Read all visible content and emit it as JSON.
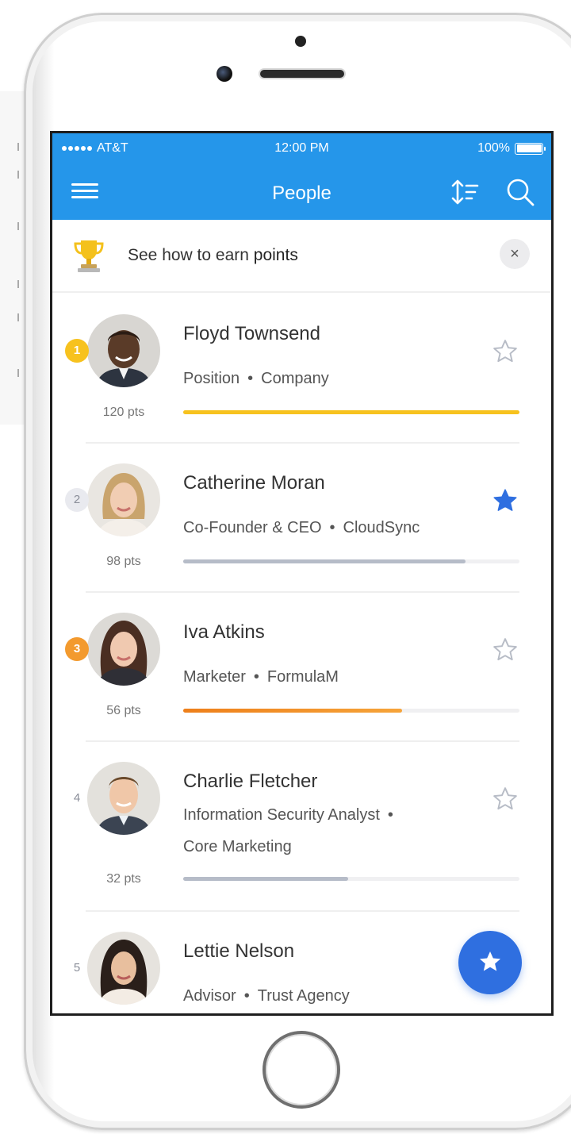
{
  "status_bar": {
    "carrier": "AT&T",
    "time": "12:00 PM",
    "battery": "100%"
  },
  "nav": {
    "title": "People",
    "menu_icon": "hamburger-icon",
    "sort_icon": "sort-icon",
    "search_icon": "search-icon"
  },
  "banner": {
    "text_prefix": "See how to earn ",
    "text_bold": "points",
    "close_label": "×",
    "icon": "trophy-icon"
  },
  "people": [
    {
      "rank": "1",
      "name": "Floyd Townsend",
      "position": "Position",
      "company": "Company",
      "points": "120 pts",
      "progress": 1.0,
      "favorite": false
    },
    {
      "rank": "2",
      "name": "Catherine Moran",
      "position": "Co-Founder & CEO",
      "company": "CloudSync",
      "points": "98 pts",
      "progress": 0.84,
      "favorite": true
    },
    {
      "rank": "3",
      "name": "Iva Atkins",
      "position": "Marketer",
      "company": "FormulaM",
      "points": "56 pts",
      "progress": 0.65,
      "favorite": false
    },
    {
      "rank": "4",
      "name": "Charlie Fletcher",
      "position": "Information Security Analyst",
      "company": "Core Marketing",
      "points": "32 pts",
      "progress": 0.49,
      "favorite": false
    },
    {
      "rank": "5",
      "name": "Lettie Nelson",
      "position": "Advisor",
      "company": "Trust Agency",
      "favorite": false
    }
  ],
  "colors": {
    "header_blue": "#2596ea",
    "gold": "#f7c21e",
    "gray": "#b6bcc8",
    "orange": "#f08a1c",
    "star_blue": "#2f6fe0"
  }
}
